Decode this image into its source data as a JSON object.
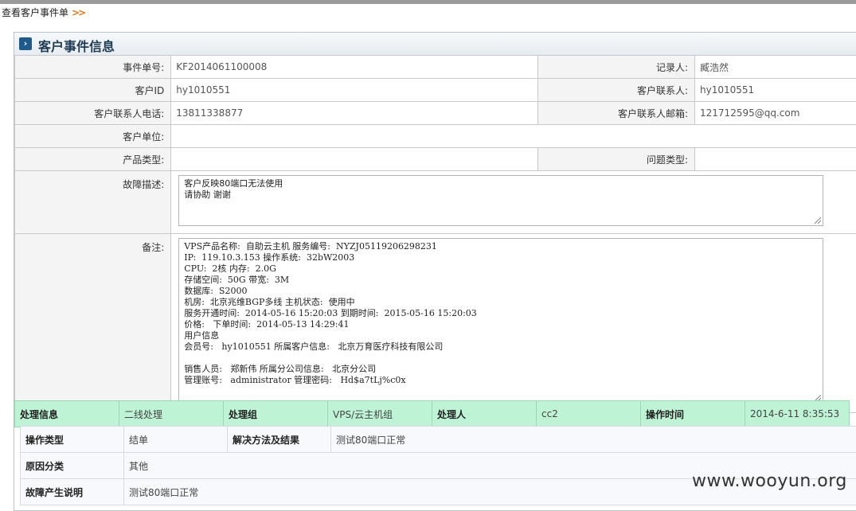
{
  "breadcrumb": {
    "text": "查看客户事件单",
    "arrows": ">>"
  },
  "panel": {
    "title": "客户事件信息",
    "icon": "chevron-right-icon"
  },
  "info": {
    "event_no_label": "事件单号:",
    "event_no": "KF2014061100008",
    "recorder_label": "记录人:",
    "recorder": "臧浩然",
    "customer_id_label": "客户ID",
    "customer_id": "hy1010551",
    "contact_label": "客户联系人:",
    "contact": "hy1010551",
    "phone_label": "客户联系人电话:",
    "phone": "13811338877",
    "email_label": "客户联系人邮箱:",
    "email": "121712595@qq.com",
    "unit_label": "客户单位:",
    "unit": "",
    "product_type_label": "产品类型:",
    "product_type": "",
    "issue_type_label": "问题类型:",
    "issue_type": "",
    "fault_label": "故障描述:",
    "fault_text": "客户反映80端口无法使用\n请协助 谢谢",
    "remark_label": "备注:",
    "remark_text": "VPS产品名称:  自助云主机 服务编号:  NYZJ05119206298231\nIP:  119.10.3.153 操作系统:  32bW2003\nCPU:  2核 内存:  2.0G\n存储空间:  50G 带宽:  3M\n数据库:  S2000\n机房:  北京兆维BGP多线 主机状态:  使用中\n服务开通时间:  2014-05-16 15:20:03 到期时间:  2015-05-16 15:20:03\n价格:   下单时间:  2014-05-13 14:29:41\n用户信息\n会员号:   hy1010551 所属客户信息:   北京万育医疗科技有限公司\n\n销售人员:   郑新伟 所属分公司信息:   北京分公司\n管理账号:   administrator 管理密码:   Hd$a7tLj%c0x"
  },
  "process": {
    "h1": "处理信息",
    "v1": "二线处理",
    "h2": "处理组",
    "v2": "VPS/云主机组",
    "h3": "处理人",
    "v3": "cc2",
    "h4": "操作时间",
    "v4": "2014-6-11 8:35:53"
  },
  "detail": {
    "op_type_label": "操作类型",
    "op_type": "结单",
    "solution_label": "解决方法及结果",
    "solution": "测试80端口正常",
    "cause_label": "原因分类",
    "cause": "其他",
    "explain_label": "故障产生说明",
    "explain": "测试80端口正常"
  },
  "watermark": "www.wooyun.org"
}
